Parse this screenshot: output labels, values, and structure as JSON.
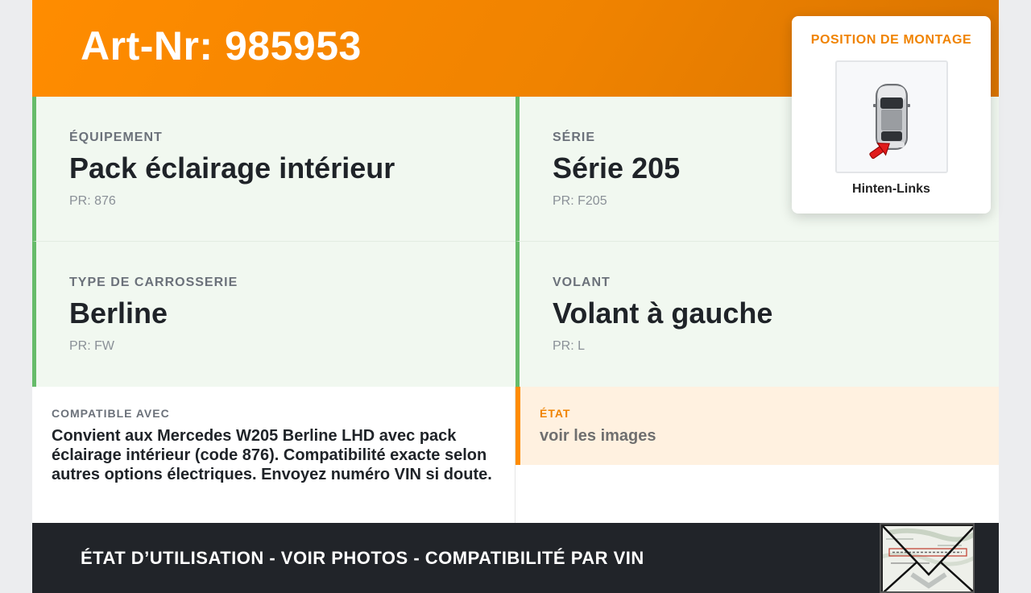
{
  "header": {
    "title": "Art-Nr: 985953"
  },
  "specs": [
    {
      "label": "ÉQUIPEMENT",
      "value": "Pack éclairage intérieur",
      "code": "PR: 876"
    },
    {
      "label": "SÉRIE",
      "value": "Série 205",
      "code": "PR: F205"
    },
    {
      "label": "TYPE DE CARROSSERIE",
      "value": "Berline",
      "code": "PR: FW"
    },
    {
      "label": "VOLANT",
      "value": "Volant à gauche",
      "code": "PR: L"
    }
  ],
  "compat": {
    "label": "COMPATIBLE AVEC",
    "text": "Convient aux Mercedes W205 Berline LHD avec pack éclairage intérieur (code 876). Compatibilité exacte selon autres options électriques. Envoyez numéro VIN si doute."
  },
  "etat": {
    "label": "ÉTAT",
    "text": "voir les images"
  },
  "footer": {
    "text": "ÉTAT D’UTILISATION - VOIR PHOTOS - COMPATIBILITÉ PAR VIN"
  },
  "position": {
    "title": "POSITION DE MONTAGE",
    "value": "Hinten-Links",
    "icon": "car-top-view-icon"
  },
  "colors": {
    "accent": "#ff8c00",
    "card_bg": "#f1f8f0",
    "card_border": "#66bb6a",
    "footer_bg": "#212429",
    "etat_bg": "#fff1e0"
  }
}
